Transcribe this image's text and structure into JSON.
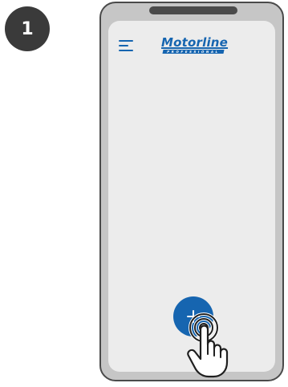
{
  "step": {
    "number": "1"
  },
  "app": {
    "logo_text": "Motorline",
    "logo_tagline": "PROFESSIONAL"
  },
  "icons": {
    "menu": "hamburger-menu-icon",
    "add": "plus-icon",
    "gesture": "tap-hand-icon"
  },
  "colors": {
    "accent": "#1665b0",
    "badge": "#3a3a3a",
    "phone_frame": "#4a4a4a",
    "screen": "#ececec"
  }
}
